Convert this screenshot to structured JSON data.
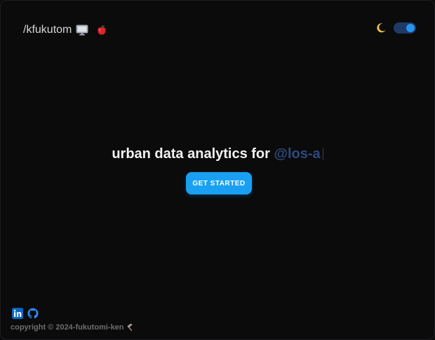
{
  "header": {
    "brand_label": "/kfukutom",
    "icons": [
      "monitor-icon",
      "apple-icon"
    ],
    "theme_icon": "moon-icon",
    "theme_toggle_on": true
  },
  "hero": {
    "title_prefix": "urban data analytics for",
    "typed_text": "@los-a",
    "cta_label": "GET STARTED"
  },
  "footer": {
    "social_icons": [
      "linkedin-icon",
      "github-icon"
    ],
    "copyright": "copyright © 2024-fukutomi-ken",
    "copyright_icon": "hammer-icon"
  },
  "colors": {
    "background": "#0b0b0c",
    "accent": "#1aa0f2",
    "typed_text": "#2e4a7e",
    "toggle_track": "#1f3a66",
    "linkedin": "#0a66c2",
    "github": "#2d8cf0"
  }
}
